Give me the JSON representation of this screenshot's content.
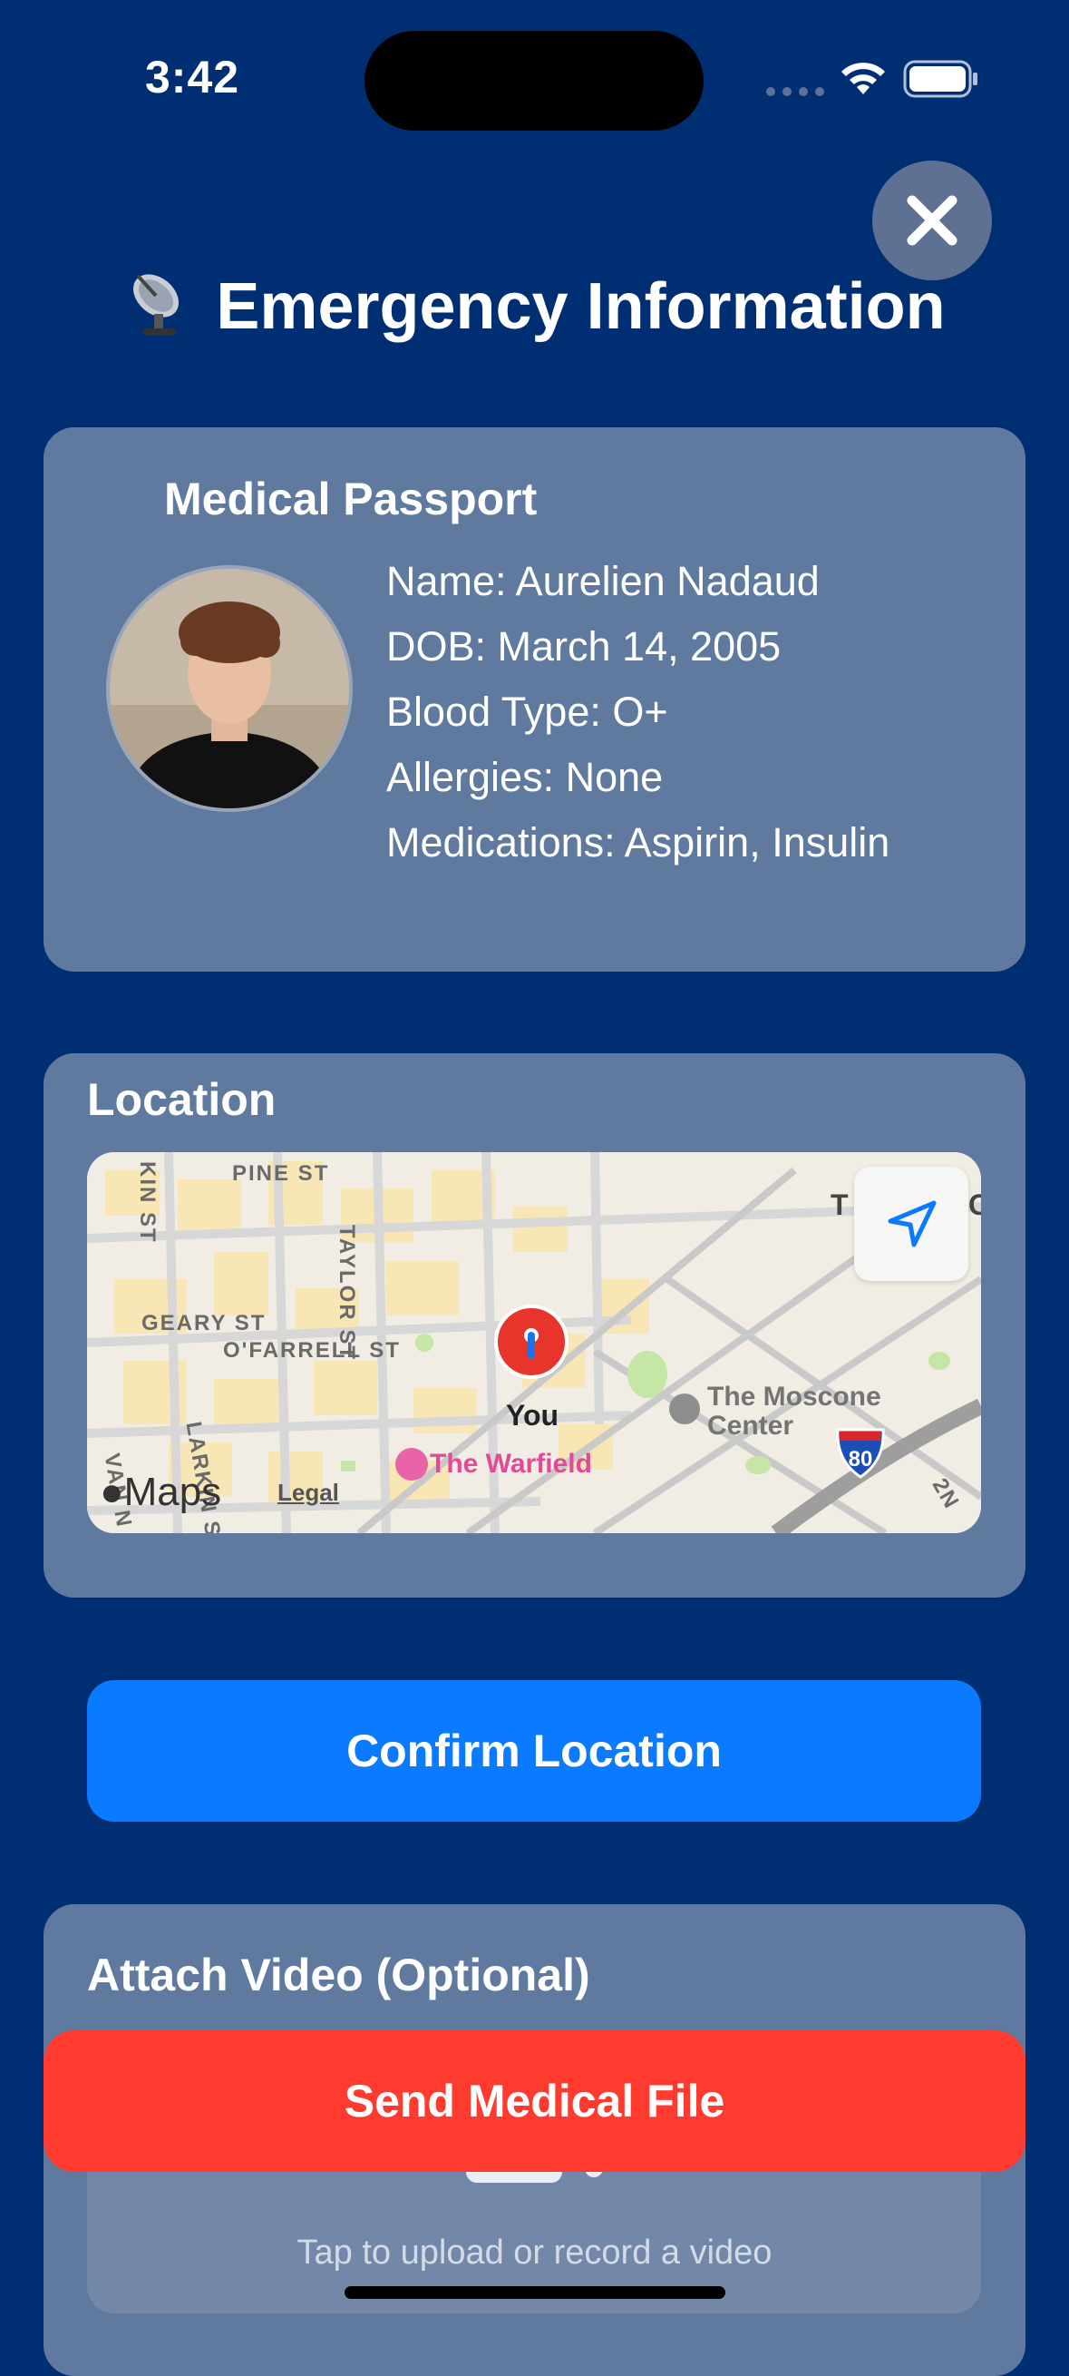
{
  "status_bar": {
    "time": "3:42"
  },
  "header": {
    "title": "Emergency Information",
    "close_icon": "close-icon"
  },
  "medical_passport": {
    "title": "Medical Passport",
    "name": "Name: Aurelien Nadaud",
    "dob": "DOB: March 14, 2005",
    "blood_type": "Blood Type: O+",
    "allergies": "Allergies: None",
    "medications": "Medications: Aspirin, Insulin"
  },
  "location": {
    "title": "Location",
    "map": {
      "streets": [
        "PINE ST",
        "TAYLOR ST",
        "GEARY ST",
        "O'FARRELL ST",
        "KIN ST",
        "LARKIN ST",
        "VAN N",
        "2N"
      ],
      "poi": [
        "You",
        "The Warfield",
        "The Moscone Center"
      ],
      "highway_shield": "80",
      "brand": "Maps",
      "legal": "Legal",
      "partial_labels": [
        "T",
        "C"
      ]
    }
  },
  "confirm_button": "Confirm Location",
  "video": {
    "title": "Attach Video (Optional)",
    "upload_hint": "Tap to upload or record a video"
  },
  "send_button": "Send Medical File",
  "colors": {
    "background": "#002e73",
    "card": "#5f7a9e",
    "confirm": "#0a7aff",
    "send": "#ff3b30"
  }
}
